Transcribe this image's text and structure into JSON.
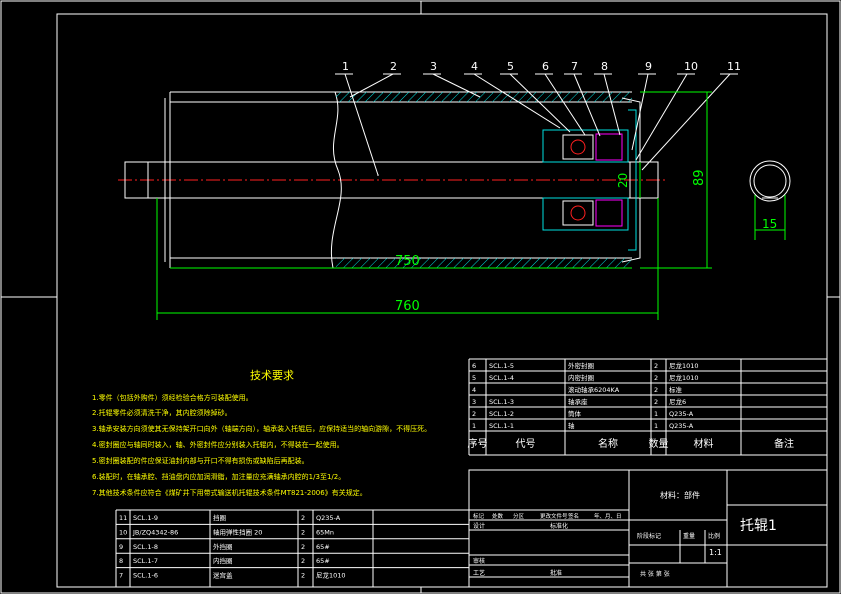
{
  "drawing": {
    "title": "托辊1",
    "material_label": "材料：部件",
    "scale": "1:1",
    "part_numbers": [
      "1",
      "2",
      "3",
      "4",
      "5",
      "6",
      "7",
      "8",
      "9",
      "10",
      "11"
    ],
    "dimensions": {
      "diameter_outer": "89",
      "diameter_shaft": "20",
      "length_inner": "750",
      "length_total": "760",
      "shaft_flat": "15"
    }
  },
  "tech_requirements": {
    "title": "技术要求",
    "items": [
      "1.零件（包括外购件）须经检验合格方可装配使用。",
      "2.托辊零件必须清洗干净，其内腔须除掉砂。",
      "3.轴承安装方向须使其无保持架开口向外（轴端方向），轴承装入托辊后，应保持适当的轴向游隙，不得压死。",
      "4.密封圈应与轴同时装入，轴、外密封件应分别装入托辊内，不得装在一起使用。",
      "5.密封圈装配的件应保证油封内部与开口不得有损伤或缺陷后再配装。",
      "6.装配时，在轴承腔、挡油盘内应加润滑脂，加注量应充满轴承内腔的1/3至1/2。",
      "7.其他技术条件应符合《煤矿井下用带式输送机托辊技术条件MT821-2006》有关规定。"
    ]
  },
  "bom_upper": {
    "rows": [
      {
        "no": "6",
        "code": "SCL.1-5",
        "name": "外密封圈",
        "qty": "2",
        "mat": "尼龙1010"
      },
      {
        "no": "5",
        "code": "SCL.1-4",
        "name": "内密封圈",
        "qty": "2",
        "mat": "尼龙1010"
      },
      {
        "no": "4",
        "code": "",
        "name": "滚动轴承6204KA",
        "qty": "2",
        "mat": "标准"
      },
      {
        "no": "3",
        "code": "SCL.1-3",
        "name": "轴承座",
        "qty": "2",
        "mat": "尼龙6"
      },
      {
        "no": "2",
        "code": "SCL.1-2",
        "name": "筒体",
        "qty": "1",
        "mat": "Q235-A"
      },
      {
        "no": "1",
        "code": "SCL.1-1",
        "name": "轴",
        "qty": "1",
        "mat": "Q235-A"
      }
    ],
    "headers": {
      "no": "序号",
      "code": "代号",
      "name": "名称",
      "qty": "数量",
      "mat": "材料",
      "note": "备注"
    }
  },
  "bom_lower": {
    "rows": [
      {
        "no": "11",
        "code": "SCL.1-9",
        "name": "挡圈",
        "qty": "2",
        "mat": "Q235-A"
      },
      {
        "no": "10",
        "code": "JB/ZQ4342-86",
        "name": "轴用弹性挡圈 20",
        "qty": "2",
        "mat": "65Mn"
      },
      {
        "no": "9",
        "code": "SCL.1-8",
        "name": "外挡圈",
        "qty": "2",
        "mat": "65#"
      },
      {
        "no": "8",
        "code": "SCL.1-7",
        "name": "内挡圈",
        "qty": "2",
        "mat": "65#"
      },
      {
        "no": "7",
        "code": "SCL.1-6",
        "name": "迷宫盖",
        "qty": "2",
        "mat": "尼龙1010"
      }
    ]
  },
  "title_block": {
    "row1": [
      "标记",
      "处数",
      "分区",
      "更改文件号",
      "签名",
      "年、月、日"
    ],
    "design": "设计",
    "standard": "标准化",
    "review": "审核",
    "craft": "工艺",
    "approve": "批准",
    "stage_label": "阶段标记",
    "weight_label": "重量",
    "scale_label": "比例",
    "sheets": "共   张   第   张"
  },
  "colors": {
    "border": "#ffffff",
    "dim": "#00ff00",
    "text_yellow": "#ffff00",
    "hatch": "#00e0e0",
    "center": "#ff2020"
  }
}
